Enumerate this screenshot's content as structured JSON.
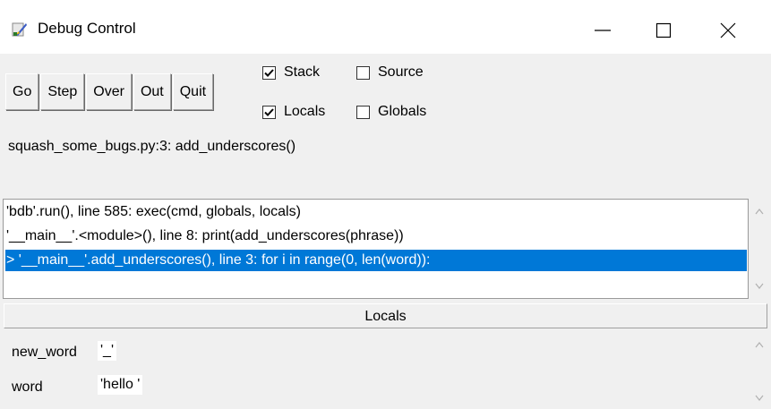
{
  "window": {
    "title": "Debug Control",
    "icons": {
      "app": "idle-feather-icon",
      "minimize": "minimize-icon",
      "maximize": "maximize-icon",
      "close": "close-icon"
    }
  },
  "toolbar": {
    "go": "Go",
    "step": "Step",
    "over": "Over",
    "out": "Out",
    "quit": "Quit"
  },
  "options": {
    "stack": {
      "label": "Stack",
      "checked": true
    },
    "source": {
      "label": "Source",
      "checked": false
    },
    "locals": {
      "label": "Locals",
      "checked": true
    },
    "globals": {
      "label": "Globals",
      "checked": false
    }
  },
  "status": "squash_some_bugs.py:3: add_underscores()",
  "stack": [
    {
      "text": "'bdb'.run(), line 585: exec(cmd, globals, locals)",
      "selected": false
    },
    {
      "text": "'__main__'.<module>(), line 8: print(add_underscores(phrase))",
      "selected": false
    },
    {
      "text": "> '__main__'.add_underscores(), line 3: for i in range(0, len(word)):",
      "selected": true
    }
  ],
  "locals": {
    "header": "Locals",
    "vars": [
      {
        "name": "new_word",
        "value": "'_'"
      },
      {
        "name": "word",
        "value": "'hello '"
      }
    ]
  },
  "colors": {
    "selection": "#0078d7",
    "background": "#f0f0f0"
  }
}
